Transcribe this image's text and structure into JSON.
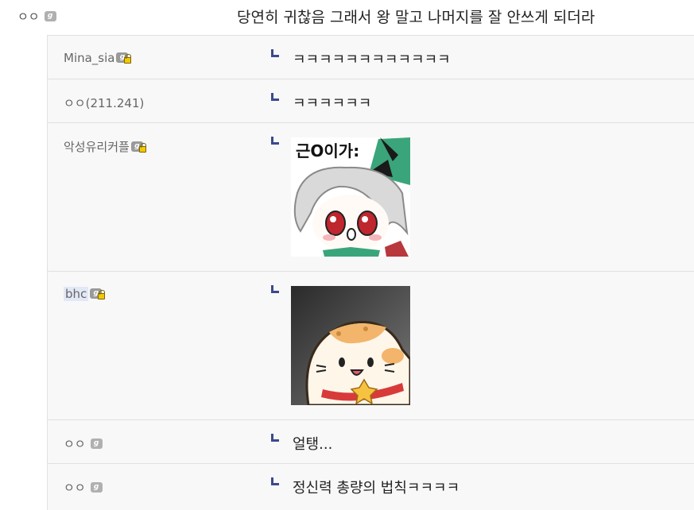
{
  "comment": {
    "author": "ㅇㅇ",
    "text": "당연히 귀찮음 그래서 왕 말고 나머지를 잘 안쓰게 되더라"
  },
  "badge_glyph": "g",
  "replies": [
    {
      "author": "Mina_sia",
      "badge": "fixed",
      "text": "ㅋㅋㅋㅋㅋㅋㅋㅋㅋㅋㅋㅋ"
    },
    {
      "author": "ㅇㅇ(211.241)",
      "badge": "none",
      "text": "ㅋㅋㅋㅋㅋㅋ"
    },
    {
      "author": "악성유리커플",
      "badge": "fixed",
      "sticker_caption": "근O이가:"
    },
    {
      "author": "bhc",
      "badge": "fixed"
    },
    {
      "author": "ㅇㅇ",
      "badge": "anon",
      "text": "얼탱..."
    },
    {
      "author": "ㅇㅇ",
      "badge": "anon",
      "text": "정신력 총량의 법칙ㅋㅋㅋㅋ"
    }
  ],
  "colors": {
    "reply_arrow": "#3b4a8c",
    "reply_bg": "#f8f8f8",
    "highlight": "#e3e8f7"
  }
}
